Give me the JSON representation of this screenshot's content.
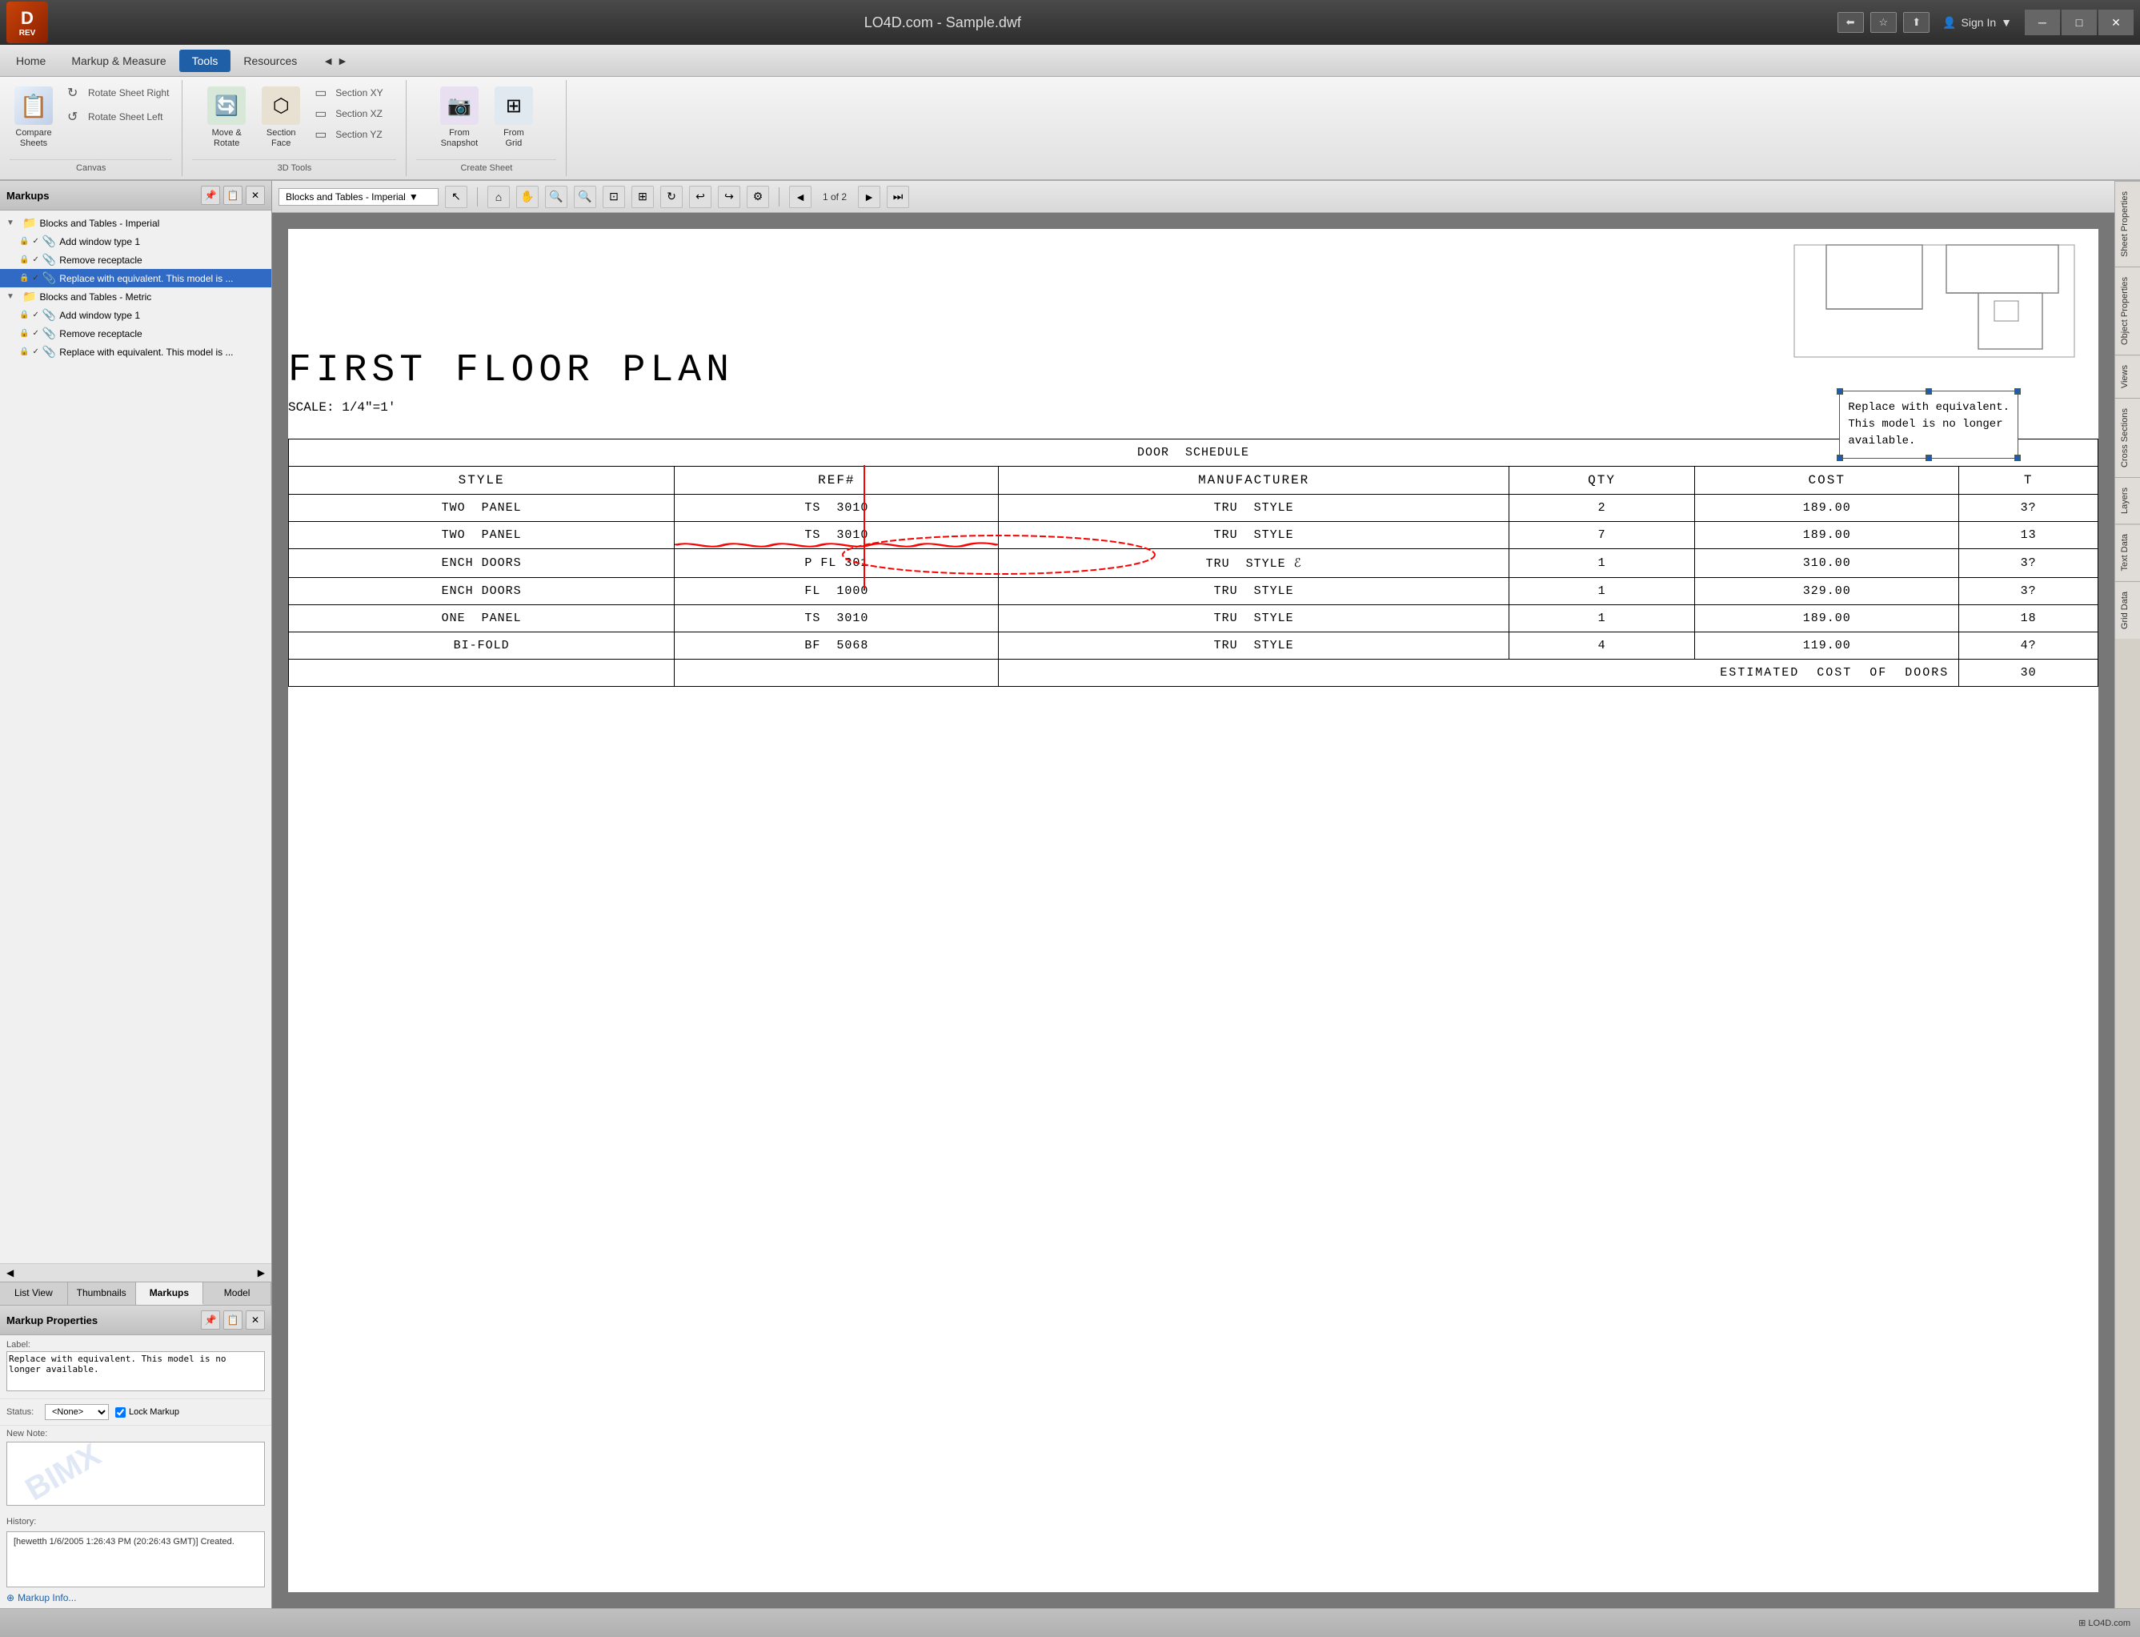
{
  "app": {
    "title": "LO4D.com - Sample.dwf",
    "logo_line1": "D",
    "logo_line2": "REV"
  },
  "title_bar": {
    "nav_back": "◀",
    "nav_forward": "▶",
    "nav_home": "⌂",
    "nav_star": "★",
    "sign_in": "Sign In",
    "minimize": "─",
    "maximize": "□",
    "close": "✕"
  },
  "menu_bar": {
    "items": [
      "Home",
      "Markup & Measure",
      "Tools",
      "Resources",
      "◄ ►"
    ]
  },
  "ribbon": {
    "canvas_group": {
      "label": "Canvas",
      "compare_sheets": "Compare\nSheets",
      "rotate_right": "Rotate Sheet Right",
      "rotate_left": "Rotate Sheet Left"
    },
    "tools_3d_group": {
      "label": "3D Tools",
      "move_rotate": "Move &\nRotate",
      "section_face": "Section\nFace",
      "section_xy": "Section XY",
      "section_xz": "Section XZ",
      "section_yz": "Section YZ"
    },
    "create_sheet_group": {
      "label": "Create Sheet",
      "from_snapshot": "From\nSnapshot",
      "from_grid": "From\nGrid"
    }
  },
  "markups_panel": {
    "title": "Markups",
    "tree": [
      {
        "level": 0,
        "type": "group",
        "label": "Blocks and Tables - Imperial",
        "expanded": true
      },
      {
        "level": 1,
        "type": "item",
        "label": "Add window type 1"
      },
      {
        "level": 1,
        "type": "item",
        "label": "Remove receptacle"
      },
      {
        "level": 1,
        "type": "item",
        "label": "Replace with equivalent. This model is ...",
        "selected": true
      },
      {
        "level": 0,
        "type": "group",
        "label": "Blocks and Tables - Metric",
        "expanded": true
      },
      {
        "level": 1,
        "type": "item",
        "label": "Add window type 1"
      },
      {
        "level": 1,
        "type": "item",
        "label": "Remove receptacle"
      },
      {
        "level": 1,
        "type": "item",
        "label": "Replace with equivalent. This model is ..."
      }
    ],
    "tabs": [
      "List View",
      "Thumbnails",
      "Markups",
      "Model"
    ],
    "active_tab": "Markups"
  },
  "markup_properties": {
    "title": "Markup Properties",
    "label_field": "Label:",
    "label_value": "Replace with equivalent. This model is no longer available.",
    "status_label": "Status:",
    "status_value": "<None>",
    "lock_label": "Lock Markup",
    "new_note_label": "New Note:",
    "watermark": "BIMX",
    "history_label": "History:",
    "history_value": "[hewetth  1/6/2005  1:26:43 PM  (20:26:43 GMT)]\nCreated.",
    "markup_info": "Markup Info..."
  },
  "content_toolbar": {
    "sheet_name": "Blocks and Tables - Imperial",
    "dropdown_arrow": "▼",
    "page_current": "1",
    "page_total": "2",
    "page_of": "of"
  },
  "drawing": {
    "floor_plan_title": "FIRST  FLOOR  PLAN",
    "scale_text": "SCALE: 1/4\"=1'",
    "door_schedule_title": "DOOR  SCHEDULE",
    "table_headers": [
      "STYLE",
      "REF#",
      "MANUFACTURER",
      "QTY",
      "COST",
      "T"
    ],
    "table_rows": [
      [
        "TWO  PANEL",
        "TS  3010",
        "TRU  STYLE",
        "2",
        "189.00",
        "3?"
      ],
      [
        "TWO  PANEL",
        "TS  3010",
        "TRU  STYLE",
        "7",
        "189.00",
        "13"
      ],
      [
        "ENCH DOORS",
        "P  FL  301",
        "TRU  STYLE  ℰ",
        "1",
        "310.00",
        "3?"
      ],
      [
        "ENCH DOORS",
        "FL  1000",
        "TRU  STYLE",
        "1",
        "329.00",
        "3?"
      ],
      [
        "ONE  PANEL",
        "TS  3010",
        "TRU  STYLE",
        "1",
        "189.00",
        "18"
      ],
      [
        "BI-FOLD",
        "BF  5068",
        "TRU  STYLE",
        "4",
        "119.00",
        "4?"
      ]
    ],
    "footer_row": [
      "",
      "",
      "",
      "ESTIMATED  COST  OF  DOORS",
      "",
      "30"
    ],
    "annotation_text": "Replace with equivalent.\nThis model is no longer\navailable."
  },
  "right_tabs": [
    "Sheet Properties",
    "Object Properties",
    "Views",
    "Cross Sections",
    "Layers",
    "Text Data",
    "Grid Data"
  ],
  "status_bar": {
    "left": "",
    "right": "⊞ LO4D.com"
  }
}
